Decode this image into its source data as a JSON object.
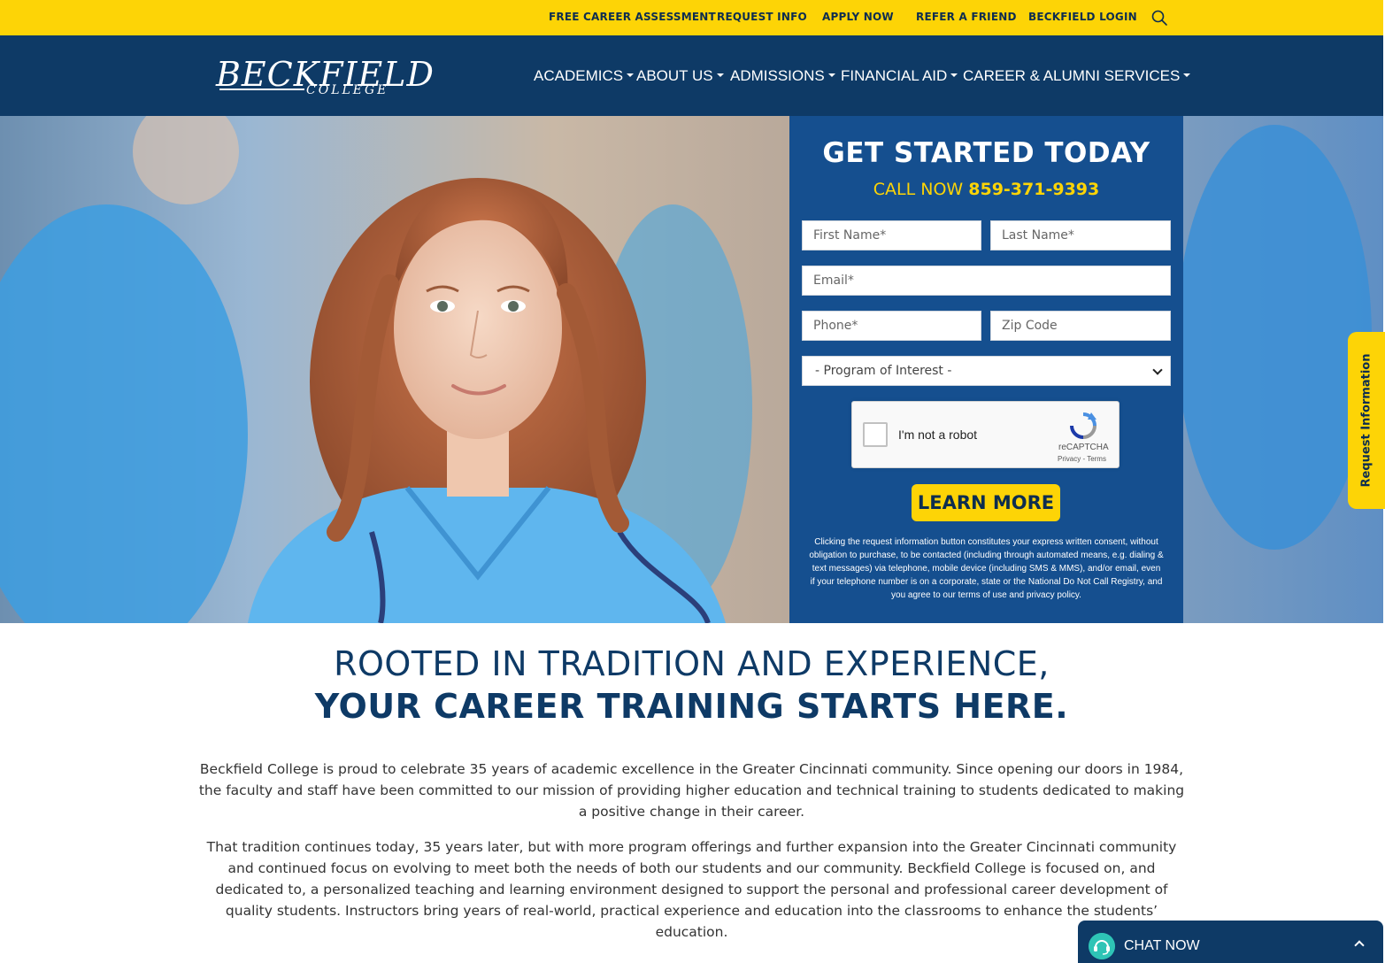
{
  "utility_bar": {
    "links": [
      {
        "label": "FREE CAREER ASSESSMENT"
      },
      {
        "label": "REQUEST INFO"
      },
      {
        "label": "APPLY NOW"
      },
      {
        "label": "REFER A FRIEND"
      },
      {
        "label": "BECKFIELD LOGIN"
      }
    ],
    "search_icon": "search-icon"
  },
  "logo": {
    "main": "BECKFIELD",
    "sub": "COLLEGE"
  },
  "nav": {
    "items": [
      {
        "label": "ACADEMICS"
      },
      {
        "label": "ABOUT US"
      },
      {
        "label": "ADMISSIONS"
      },
      {
        "label": "FINANCIAL AID"
      },
      {
        "label": "CAREER & ALUMNI SERVICES"
      }
    ]
  },
  "form": {
    "title": "GET STARTED TODAY",
    "call_prefix": "CALL NOW",
    "phone": "859-371-9393",
    "first_name_placeholder": "First Name*",
    "last_name_placeholder": "Last Name*",
    "email_placeholder": "Email*",
    "phone_placeholder": "Phone*",
    "zip_placeholder": "Zip Code",
    "program_select": "- Program of Interest -",
    "recaptcha_label": "I'm not a robot",
    "recaptcha_brand": "reCAPTCHA",
    "recaptcha_links": "Privacy - Terms",
    "submit_label": "LEARN MORE",
    "disclaimer": "Clicking the request information button constitutes your express written consent, without obligation to purchase, to be contacted (including through automated means, e.g. dialing & text messages) via telephone, mobile device (including SMS & MMS), and/or email, even if your telephone number is on a corporate, state or the National Do Not Call Registry, and you agree to our terms of use and privacy policy."
  },
  "side_tab": {
    "label": "Request Information"
  },
  "content": {
    "headline_line1": "ROOTED IN TRADITION AND EXPERIENCE,",
    "headline_line2": "YOUR CAREER TRAINING STARTS HERE.",
    "paragraph1": "Beckfield College is proud to celebrate 35 years of academic excellence in the Greater Cincinnati community. Since opening our doors in 1984, the faculty and staff have been committed to our mission of providing higher education and technical training to students dedicated to making a positive change in their career.",
    "paragraph2": "That tradition continues today, 35 years later, but with more program offerings and further expansion into the Greater Cincinnati community and continued focus on evolving to meet both the needs of both our students and our community. Beckfield College is focused on, and dedicated to, a personalized teaching and learning environment designed to support the personal and professional career development of quality students. Instructors bring years of real-world, practical experience and education into the classrooms to enhance the students’ education."
  },
  "chat": {
    "label": "CHAT NOW"
  },
  "colors": {
    "brand_navy": "#0e3a66",
    "brand_yellow": "#fdd406",
    "form_blue": "#154f8f",
    "chat_accent": "#2ec4b6"
  }
}
